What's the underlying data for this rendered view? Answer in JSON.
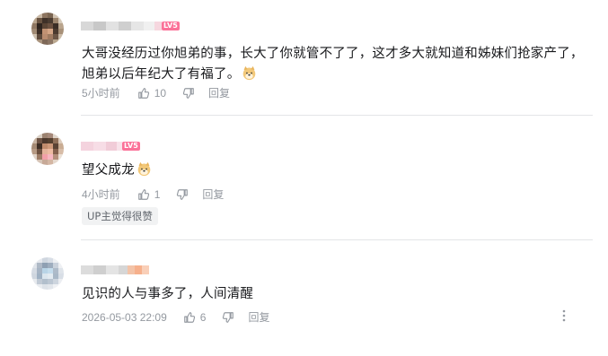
{
  "comments": [
    {
      "text": "大哥没经历过你旭弟的事，长大了你就管不了了，这才多大就知道和姊妹们抢家产了，旭弟以后年纪大了有福了。",
      "emoji": "doge-emoji",
      "time": "5小时前",
      "likes": "10",
      "reply_label": "回复",
      "level_badge": "LV5"
    },
    {
      "text": "望父成龙",
      "emoji": "doge-emoji",
      "time": "4小时前",
      "likes": "1",
      "reply_label": "回复",
      "level_badge": "LV5",
      "up_badge": "UP主觉得很赞"
    },
    {
      "text": "见识的人与事多了，人间清醒",
      "time": "2026-05-03 22:09",
      "likes": "6",
      "reply_label": "回复"
    }
  ],
  "colors": {
    "text": "#18191c",
    "meta": "#9499a0",
    "divider": "#e3e5e7",
    "level_badge": "#fb7299"
  }
}
